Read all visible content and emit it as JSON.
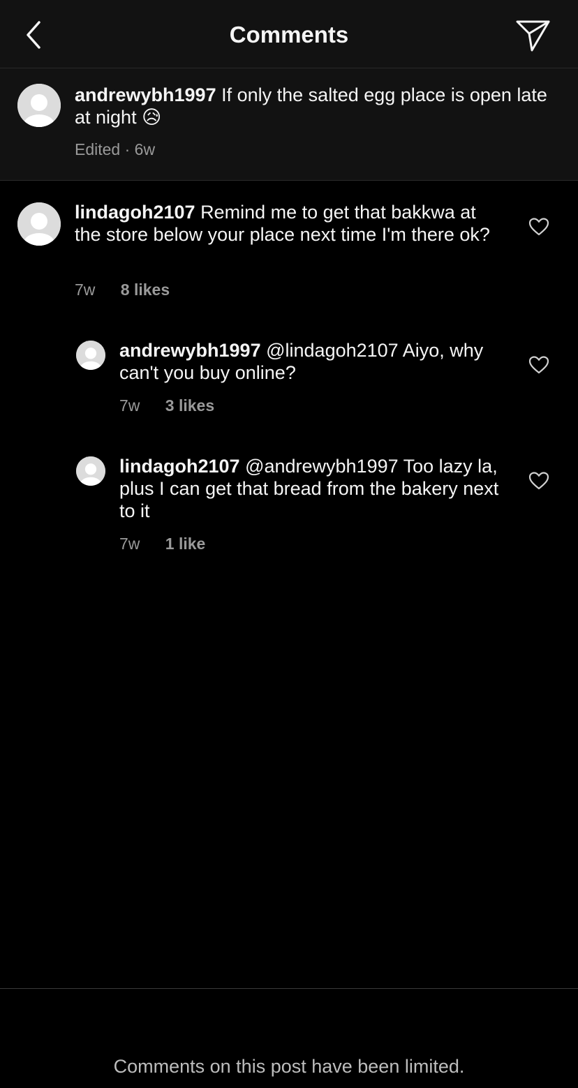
{
  "header": {
    "title": "Comments"
  },
  "caption": {
    "username": "andrewybh1997",
    "text": "If only the salted egg place is open late at night",
    "emoji": "😥",
    "meta": "Edited · 6w"
  },
  "comments": [
    {
      "username": "lindagoh2107",
      "text": "Remind me to get that bakkwa at the store below your place next time I'm there ok?",
      "time": "7w",
      "likes": "8 likes"
    },
    {
      "username": "andrewybh1997",
      "text": "@lindagoh2107 Aiyo, why can't you buy online?",
      "time": "7w",
      "likes": "3 likes"
    },
    {
      "username": "lindagoh2107",
      "text": "@andrewybh1997 Too lazy la, plus I can get that bread from the bakery next to it",
      "time": "7w",
      "likes": "1 like"
    }
  ],
  "footer": {
    "notice": "Comments on this post have been limited."
  },
  "icons": {
    "back": "chevron-left-icon",
    "send": "paper-plane-icon",
    "like": "heart-outline-icon",
    "avatar": "default-avatar-icon"
  }
}
